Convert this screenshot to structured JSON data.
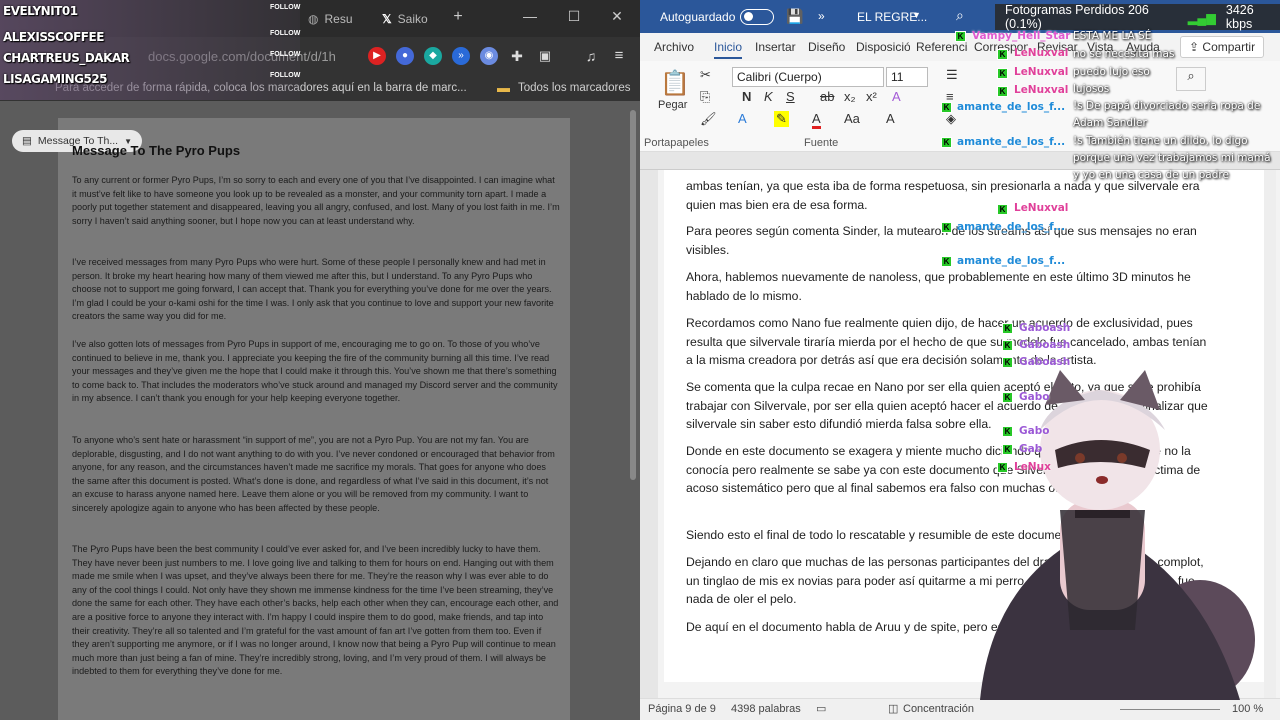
{
  "overlay": {
    "viewers": [
      {
        "name": "EVELYNIT01",
        "follow": "FOLLOW"
      },
      {
        "name": "ALEXISSCOFFEE",
        "follow": "FOLLOW"
      },
      {
        "name": "CHARTREUS_DAKAR",
        "follow": "FOLLOW"
      },
      {
        "name": "LISAGAMING525",
        "follow": "FOLLOW"
      }
    ],
    "stats": {
      "frames": "Fotogramas Perdidos 206 (0.1%)",
      "bitrate": "3426 kbps"
    }
  },
  "browser": {
    "tabs": [
      {
        "label": "Resu"
      },
      {
        "label": "Saiko"
      }
    ],
    "url": "docs.google.com/document/d/1h",
    "bookmarks_hint": "Para acceder de forma rápida, coloca los marcadores aquí en la barra de marc...",
    "all_bookmarks": "Todos los marcadores",
    "doc": {
      "chip": "Message To Th...",
      "title": "Message To The Pyro Pups",
      "paragraphs": [
        "To any current or former Pyro Pups, I’m so sorry to each and every one of you that I’ve disappointed. I can imagine what it must’ve felt like to have someone you look up to be revealed as a monster, and your community torn apart. I made a poorly put together statement and disappeared, leaving you all angry, confused, and lost. Many of you lost faith in me. I’m sorry I haven’t said anything sooner, but I hope now you can at least understand why.",
        "I’ve received messages from many Pyro Pups who were hurt. Some of these people I personally knew and had met in person. It broke my heart hearing how many of them viewed me after this, but I understand. To any Pyro Pups who choose not to support me going forward, I can accept that. Thank you for everything you’ve done for me over the years. I’m glad I could be your o-kami oshi for the time I was. I only ask that you continue to love and support your new favorite creators the same way you did for me.",
        "I’ve also gotten lots of messages from Pyro Pups in support of me, encouraging me to go on. To those of you who’ve continued to believe in me, thank you. I appreciate you keeping the fire of the community burning all this time. I’ve read your messages and they’ve given me the hope that I could make it through this. You’ve shown me that there’s something to come back to. That includes the moderators who’ve stuck around and managed my Discord server and the community in my absence. I can’t thank you enough for your help keeping everyone together.",
        "To anyone who’s sent hate or harassment “in support of me”, you are not a Pyro Pup. You are not my fan. You are deplorable, disgusting, and I do not want anything to do with you. I’ve never condoned or encouraged that behavior from anyone, for any reason, and the circumstances haven’t made me sacrifice my morals. That goes for anyone who does the same after this document is posted. What’s done is done, and regardless of what I’ve said in this document, it’s not an excuse to harass anyone named here. Leave them alone or you will be removed from my community. I want to sincerely apologize again to anyone who has been affected by these people.",
        "The Pyro Pups have been the best community I could’ve ever asked for, and I’ve been incredibly lucky to have them. They have never been just numbers to me. I love going live and talking to them for hours on end. Hanging out with them made me smile when I was upset, and they’ve always been there for me. They’re the reason why I was ever able to do any of the cool things I could. Not only have they shown me immense kindness for the time I’ve been streaming, they’ve done the same for each other. They have each other’s backs, help each other when they can, encourage each other, and are a positive force to anyone they interact with. I’m happy I could inspire them to do good, make friends, and tap into their creativity. They’re all so talented and I’m grateful for the vast amount of fan art I’ve gotten from them too. Even if they aren’t supporting me anymore, or if I was no longer around, I know now that being a Pyro Pup will continue to mean much more than just being a fan of mine. They’re incredibly strong, loving, and I’m very proud of them. I will always be indebted to them for everything they’ve done for me."
      ]
    }
  },
  "word": {
    "autosave": "Autoguardado",
    "doc_title": "EL REGRE...",
    "tabs": [
      "Archivo",
      "Inicio",
      "Insertar",
      "Diseño",
      "Disposición",
      "Referencias",
      "Correspondencia",
      "Revisar",
      "Vista",
      "Ayuda"
    ],
    "share": "Compartir",
    "font": "Calibri (Cuerpo)",
    "size": "11",
    "groups": {
      "clipboard": "Portapapeles",
      "font": "Fuente",
      "paste": "Pegar"
    },
    "paragraphs": [
      "ambas tenían, ya que esta iba de forma respetuosa, sin presionarla a nada y que silvervale era quien mas bien era de esa forma.",
      "Para peores según comenta Sinder, la mutearon de los streams así que sus mensajes no eran visibles.",
      "Ahora, hablemos nuevamente de nanoless, que probablemente en este último 3D minutos he hablado de lo mismo.",
      "Recordamos como Nano fue realmente quien dijo, de hacer un acuerdo de exclusividad, pues resulta que silvervale tiraría mierda por el hecho de que su modelo fue cancelado, ambas tenían a la misma creadora por detrás así que era decisión solamente de la artista.",
      "Se comenta que la culpa recae en Nano por ser ella quien aceptó el trato, ya que se le prohibía trabajar con Silvervale, por ser ella quien aceptó hacer el acuerdo de modelo y para finalizar que silvervale sin saber esto difundió mierda falsa sobre ella.",
      "Donde en este documento se exagera y miente mucho diciendo que Nano no decía que no la conocía pero realmente se sabe ya con este documento que Silvervale solo dice ser víctima de acoso sistemático pero que al final sabemos era falso con muchas otras cosas.",
      "Siendo esto el final de todo lo rescatable y resumible de este documento.",
      "Dejando en claro que muchas de las personas participantes del drama se vieron en un complot, un tinglao de mis ex novias para poder así quitarme a mi perro, chiste, chiste, al menos no fue nada de oler el pelo.",
      "De aquí en el documento habla de Aruu y de spite, pero es muy largo, y finaliza el documento"
    ],
    "status": {
      "page": "Página 9 de 9",
      "words": "4398 palabras",
      "focus": "Concentración",
      "zoom": "100 %"
    }
  },
  "chat": {
    "names": [
      {
        "name": "Vampy_Hell_Star",
        "color": "#e05ad0"
      },
      {
        "name": "LeNuxval",
        "color": "#e0409a"
      },
      {
        "name": "LeNuxval",
        "color": "#e0409a"
      },
      {
        "name": "LeNuxval",
        "color": "#e0409a"
      },
      {
        "name": "amante_de_los_f...",
        "color": "#1f8bd8"
      },
      {
        "name": "amante_de_los_f...",
        "color": "#1f8bd8"
      },
      {
        "name": "LeNuxval",
        "color": "#e0409a"
      },
      {
        "name": "amante_de_los_f...",
        "color": "#1f8bd8"
      },
      {
        "name": "amante_de_los_f...",
        "color": "#1f8bd8"
      },
      {
        "name": "Gaboash",
        "color": "#9b59d6"
      },
      {
        "name": "Gaboash",
        "color": "#9b59d6"
      },
      {
        "name": "Gaboash",
        "color": "#9b59d6"
      },
      {
        "name": "Gabo",
        "color": "#9b59d6"
      },
      {
        "name": "Gabo",
        "color": "#9b59d6"
      },
      {
        "name": "Gab",
        "color": "#9b59d6"
      },
      {
        "name": "LeNux",
        "color": "#e0409a"
      }
    ],
    "messages": [
      "ESTA ME LA SÉ",
      "no se necesita mas",
      "puedo lujo eso",
      "lujosos",
      "!s De papá divorciado sería ropa de Adam Sandler",
      "!s También tiene un dildo, lo digo porque una vez trabajamos mi mamá y yo en una casa de un padre"
    ]
  }
}
